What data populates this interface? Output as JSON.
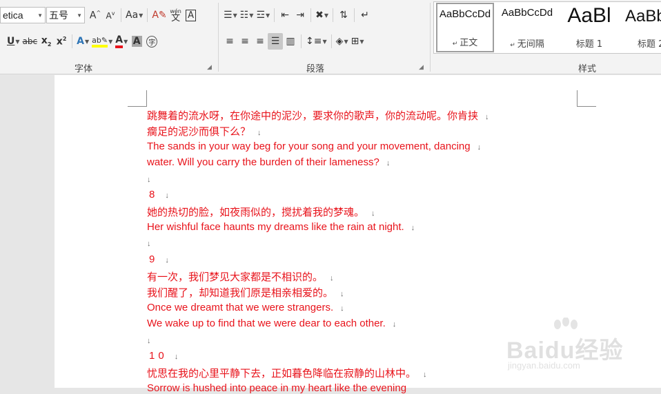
{
  "ribbon": {
    "font_name": "etica",
    "font_size": "五号",
    "font_group_label": "字体",
    "paragraph_group_label": "段落",
    "styles_group_label": "样式",
    "phonetic_guide_top": "wén",
    "phonetic_guide_char": "文",
    "text_effects_label": "Aa",
    "enclosed_char": "字",
    "styles": [
      {
        "sample": "AaBbCcDd",
        "name": "正文"
      },
      {
        "sample": "AaBbCcDd",
        "name": "无间隔"
      },
      {
        "sample": "AaBl",
        "name": "标题 1"
      },
      {
        "sample": "AaBb",
        "name": "标题 2"
      }
    ]
  },
  "document": {
    "lines": [
      "跳舞着的流水呀，在你途中的泥沙，要求你的歌声，你的流动呢。你肯挟",
      "瘸足的泥沙而俱下么？",
      "The sands in your way beg for your song and your movement, dancing",
      "water. Will you carry the burden of their lameness?",
      "",
      "8",
      "她的热切的脸，如夜雨似的，搅扰着我的梦魂。",
      "Her wishful face haunts my dreams like the rain at night.",
      "",
      "9",
      "有一次，我们梦见大家都是不相识的。",
      "我们醒了，却知道我们原是相亲相爱的。",
      "Once we dreamt that we were strangers.",
      "We wake up to find that we were dear to each other.",
      "",
      "10",
      "忧思在我的心里平静下去，正如暮色降临在寂静的山林中。",
      "Sorrow is hushed into peace in my heart like the evening"
    ],
    "paragraph_mark": "↓"
  },
  "watermark": {
    "brand": "Baidu经验",
    "url": "jingyan.baidu.com"
  }
}
